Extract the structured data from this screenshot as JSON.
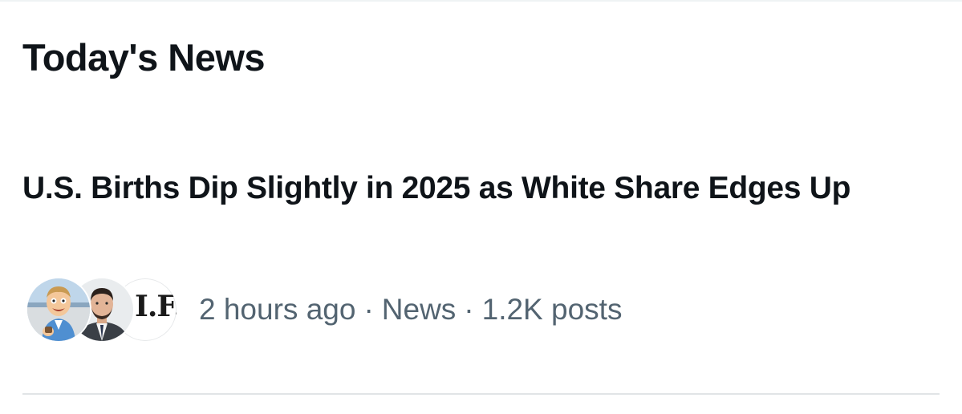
{
  "section": {
    "title": "Today's News"
  },
  "story": {
    "headline": "U.S. Births Dip Slightly in 2025 as White Share Edges Up",
    "time_ago": "2 hours ago",
    "category": "News",
    "post_count": "1.2K posts",
    "separator": "·",
    "avatars": [
      {
        "name": "cartoon-avatar"
      },
      {
        "name": "person-avatar"
      },
      {
        "name": "source-logo-avatar",
        "logo_text": "I.F."
      }
    ]
  },
  "colors": {
    "text_primary": "#0f1419",
    "text_secondary": "#536471",
    "divider": "#e1e4e6"
  }
}
